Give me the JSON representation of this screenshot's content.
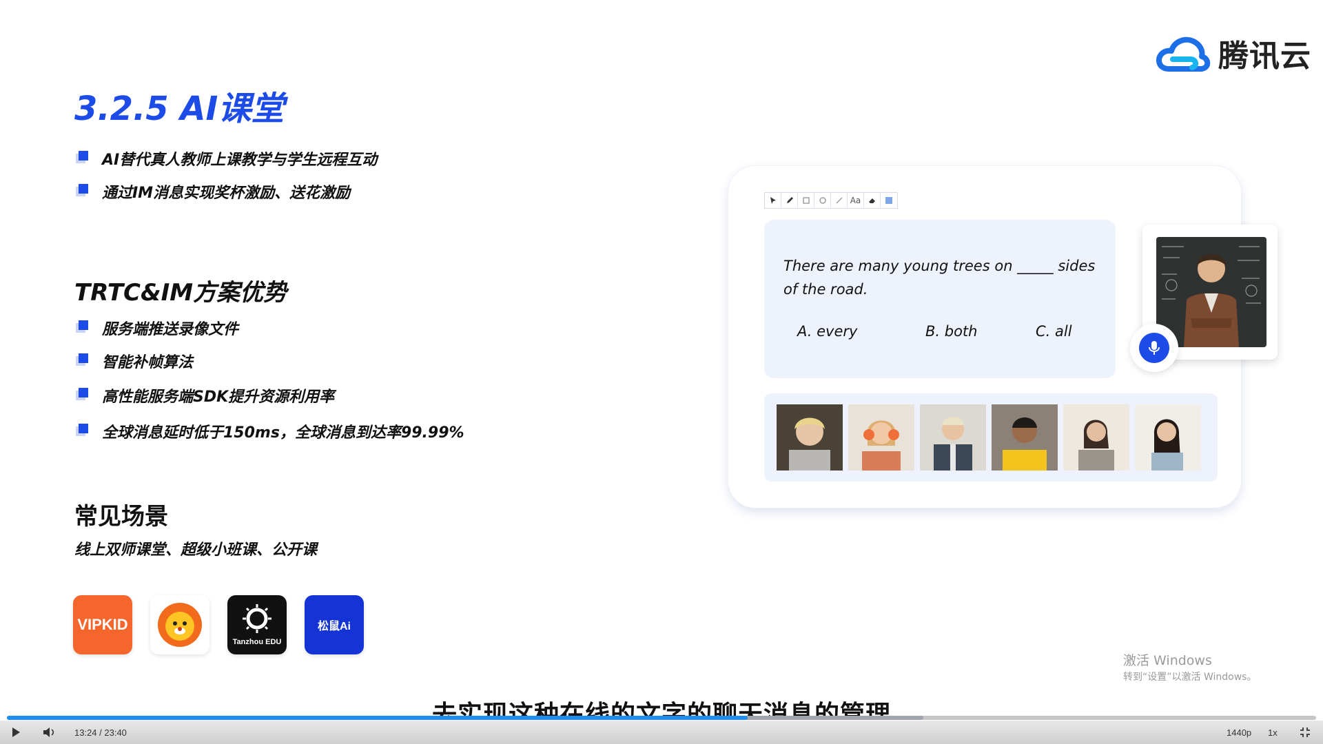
{
  "brand": {
    "name": "腾讯云",
    "color": "#1d6fe8"
  },
  "title": "3.2.5 AI课堂",
  "features": [
    "AI替代真人教师上课教学与学生远程互动",
    "通过IM消息实现奖杯激励、送花激励"
  ],
  "advantages": {
    "heading": "TRTC&IM方案优势",
    "items": [
      "服务端推送录像文件",
      "智能补帧算法",
      "高性能服务端SDK提升资源利用率",
      "全球消息延时低于150ms，全球消息到达率99.99%"
    ]
  },
  "scenarios": {
    "heading": "常见场景",
    "text": "线上双师课堂、超级小班课、公开课"
  },
  "apps": [
    {
      "name": "vipkid",
      "label": "VIPKID"
    },
    {
      "name": "lion-app",
      "label": ""
    },
    {
      "name": "tanzhou",
      "label": "Tanzhou EDU"
    },
    {
      "name": "songshu-ai",
      "label": "松鼠Ai"
    }
  ],
  "classroom": {
    "toolbar": [
      "pointer-icon",
      "pen-icon",
      "rect-icon",
      "circle-icon",
      "line-icon",
      "text-icon",
      "eraser-icon",
      "color-icon"
    ],
    "text_tool_label": "Aa",
    "question": "There are many young trees on _____ sides of the road.",
    "options": [
      "A. every",
      "B. both",
      "C. all"
    ]
  },
  "watermark": {
    "line1": "激活 Windows",
    "line2": "转到“设置”以激活 Windows。"
  },
  "subtitle": "去实现这种在线的文字的聊天消息的管理",
  "player": {
    "time": "13:24 / 23:40",
    "progress": 0.566,
    "quality": "1440p",
    "speed": "1x"
  },
  "colors": {
    "accent": "#1d4be8",
    "progress": "#1e8ef0"
  }
}
